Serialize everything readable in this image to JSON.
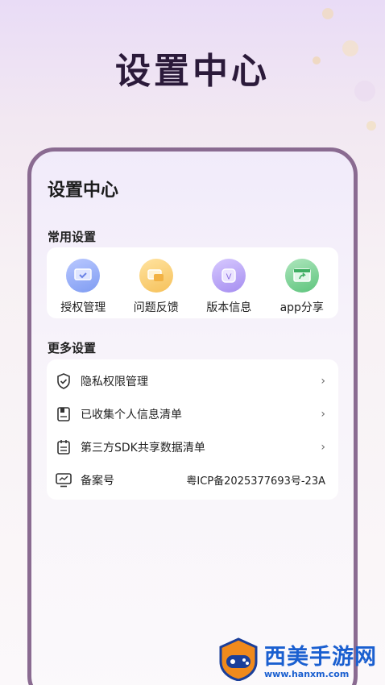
{
  "hero": {
    "title": "设置中心"
  },
  "screen": {
    "title": "设置中心",
    "common_label": "常用设置",
    "common_items": [
      {
        "label": "授权管理",
        "icon": "auth-icon",
        "color": "#7f9cf2"
      },
      {
        "label": "问题反馈",
        "icon": "feedback-icon",
        "color": "#f6c15a"
      },
      {
        "label": "版本信息",
        "icon": "version-icon",
        "color": "#a58df0"
      },
      {
        "label": "app分享",
        "icon": "share-icon",
        "color": "#5dc47c"
      }
    ],
    "more_label": "更多设置",
    "more_items": [
      {
        "label": "隐私权限管理",
        "icon": "shield-icon",
        "trail": "›"
      },
      {
        "label": "已收集个人信息清单",
        "icon": "book-icon",
        "trail": "›"
      },
      {
        "label": "第三方SDK共享数据清单",
        "icon": "calendar-list-icon",
        "trail": "›"
      },
      {
        "label": "备案号",
        "icon": "monitor-icon",
        "value": "粤ICP备2025377693号-23A"
      }
    ]
  },
  "watermark": {
    "cn": "西美手游网",
    "url": "www.hanxm.com"
  }
}
